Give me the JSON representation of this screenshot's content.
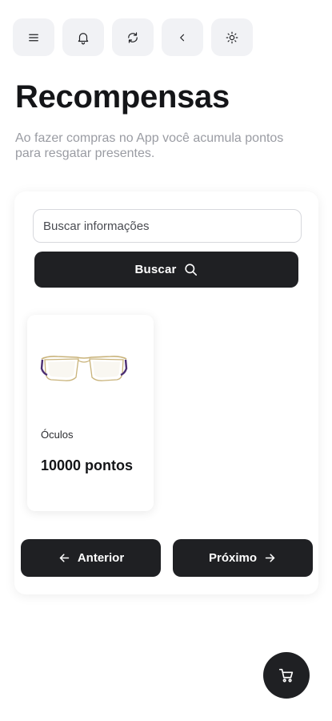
{
  "toolbar": {
    "buttons": [
      {
        "icon": "menu-icon"
      },
      {
        "icon": "bell-icon"
      },
      {
        "icon": "refresh-icon"
      },
      {
        "icon": "chevron-left-icon"
      },
      {
        "icon": "sun-icon"
      }
    ]
  },
  "header": {
    "title": "Recompensas",
    "subtitle": "Ao fazer compras no App você acumula pontos para resgatar presentes."
  },
  "search": {
    "placeholder": "Buscar informações",
    "value": "",
    "button_label": "Buscar",
    "button_icon": "search-icon"
  },
  "products": [
    {
      "name": "Óculos",
      "points": "10000 pontos",
      "image_icon": "glasses-icon"
    }
  ],
  "pagination": {
    "prev_label": "Anterior",
    "next_label": "Próximo"
  },
  "cart": {
    "icon": "cart-icon"
  },
  "colors": {
    "primary": "#1f2023",
    "background": "#ffffff",
    "toolbar_button_bg": "#f1f2f5",
    "subtitle_text": "#9a9ca3"
  }
}
